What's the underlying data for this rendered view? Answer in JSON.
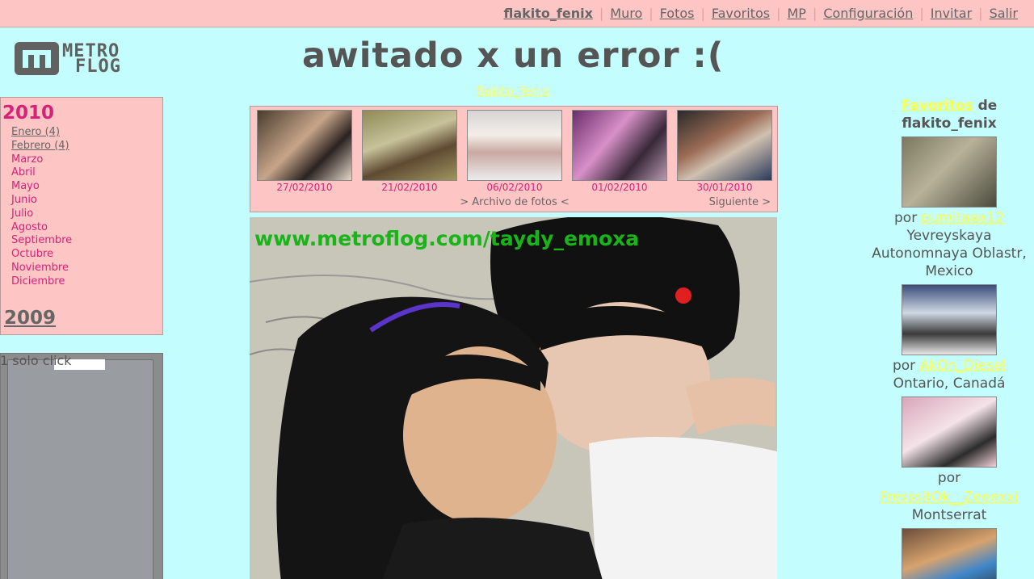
{
  "nav": {
    "items": [
      "flakito_fenix",
      "Muro",
      "Fotos",
      "Favoritos",
      "MP",
      "Configuración",
      "Invitar",
      "Salir"
    ],
    "separator": "|"
  },
  "logo": {
    "line1": "METRO",
    "line2": "FLOG"
  },
  "header": {
    "title": "awitado x un error :(",
    "owner": "flakito_fenix"
  },
  "archive": {
    "current_year": "2010",
    "months": [
      {
        "label": "Enero (4)",
        "link": true
      },
      {
        "label": "Febrero (4)",
        "link": true
      },
      {
        "label": "Marzo",
        "link": false
      },
      {
        "label": "Abril",
        "link": false
      },
      {
        "label": "Mayo",
        "link": false
      },
      {
        "label": "Junio",
        "link": false
      },
      {
        "label": "Julio",
        "link": false
      },
      {
        "label": "Agosto",
        "link": false
      },
      {
        "label": "Septiembre",
        "link": false
      },
      {
        "label": "Octubre",
        "link": false
      },
      {
        "label": "Noviembre",
        "link": false
      },
      {
        "label": "Diciembre",
        "link": false
      }
    ],
    "previous_year": "2009"
  },
  "ad_box": {
    "caption": "1 solo click"
  },
  "thumbs": {
    "dates": [
      "27/02/2010",
      "21/02/2010",
      "06/02/2010",
      "01/02/2010",
      "30/01/2010"
    ],
    "archive_label": "> Archivo de fotos <",
    "next_label": "Siguiente >"
  },
  "photo": {
    "watermark": "www.metroflog.com/taydy_emoxa"
  },
  "favorites": {
    "title_link": "Favoritos",
    "title_de": "de",
    "title_user": "flakito_fenix",
    "por": "por",
    "items": [
      {
        "user": "pumitaaa12",
        "location": "Yevreyskaya Autonomnaya Oblastr, Mexico"
      },
      {
        "user": "AkOn_Diesel",
        "location": "Ontario, Canadá"
      },
      {
        "user": "FresssitOk__Zeeexxi",
        "location": "Montserrat"
      }
    ]
  },
  "colors": {
    "background": "#c4fdfd",
    "nav_bg": "#fec5c5",
    "accent": "#d5237a",
    "link_yellow": "#ffff44",
    "watermark": "#18b418"
  }
}
